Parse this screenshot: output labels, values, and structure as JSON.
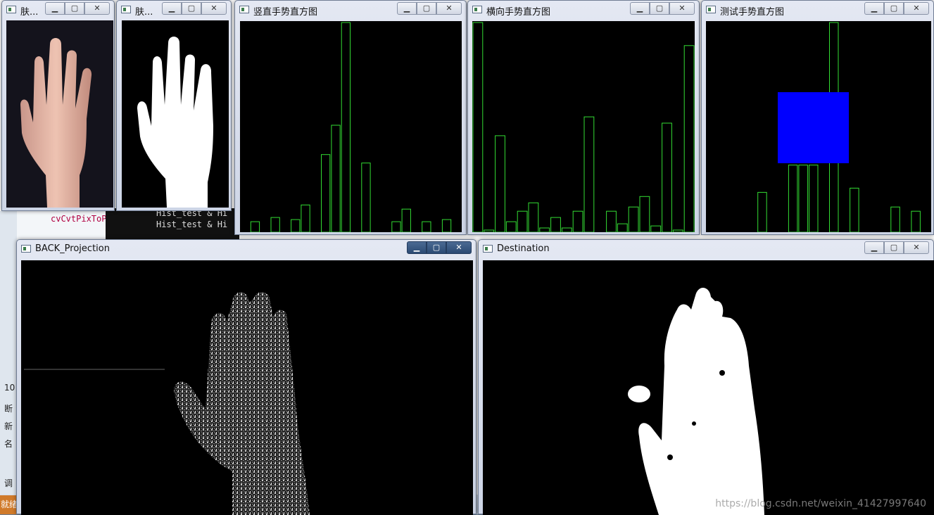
{
  "windows": {
    "skin1": {
      "title": "肤..."
    },
    "skin2": {
      "title": "肤..."
    },
    "vertical": {
      "title": "竖直手势直方图"
    },
    "horizontal": {
      "title": "横向手势直方图"
    },
    "test": {
      "title": "测试手势直方图"
    },
    "back_projection": {
      "title": "BACK_Projection"
    },
    "destination": {
      "title": "Destination"
    }
  },
  "window_controls": {
    "minimize": "▁",
    "maximize": "▢",
    "close": "✕"
  },
  "background_app": {
    "code_left": "cvCvtPixToP",
    "code_line1": "Hist_test & Hi",
    "code_line2": "Hist_test & Hi",
    "side_labels": [
      "10",
      "断",
      "新",
      "名",
      "调"
    ],
    "status": "就绪"
  },
  "watermark": "https://blog.csdn.net/weixin_41427997640",
  "colors": {
    "histogram": "#33dd33",
    "test_square": "#0000ff",
    "accent_dark": "#2b4a73"
  },
  "chart_data": [
    {
      "type": "bar",
      "title": "竖直手势直方图",
      "ylim": [
        0,
        100
      ],
      "values": [
        0,
        5,
        0,
        7,
        0,
        6,
        13,
        0,
        37,
        51,
        100,
        0,
        33,
        0,
        0,
        5,
        11,
        0,
        5,
        0,
        6,
        0
      ]
    },
    {
      "type": "bar",
      "title": "横向手势直方图",
      "ylim": [
        0,
        100
      ],
      "values": [
        100,
        1,
        46,
        5,
        10,
        14,
        2,
        7,
        2,
        10,
        55,
        0,
        10,
        4,
        12,
        17,
        3,
        52,
        1,
        89
      ]
    },
    {
      "type": "bar",
      "title": "测试手势直方图",
      "ylim": [
        0,
        100
      ],
      "values": [
        0,
        0,
        0,
        0,
        0,
        19,
        0,
        0,
        32,
        32,
        32,
        0,
        100,
        0,
        21,
        0,
        0,
        0,
        12,
        0,
        10,
        0
      ]
    }
  ]
}
